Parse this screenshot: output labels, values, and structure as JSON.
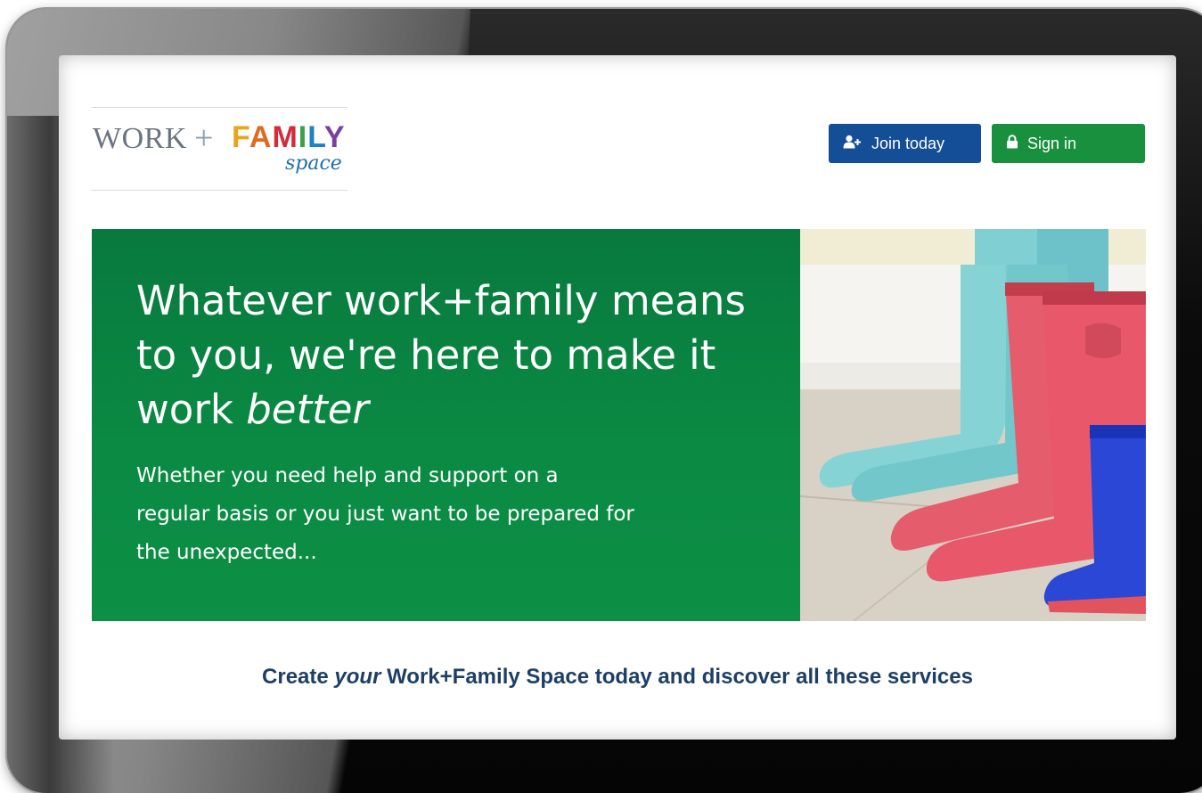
{
  "logo": {
    "work": "WORK",
    "plus": "+",
    "family_letters": [
      "F",
      "A",
      "M",
      "I",
      "L",
      "Y"
    ],
    "space": "space"
  },
  "header": {
    "join_label": "Join today",
    "join_icon": "add-user-icon",
    "sign_in_label": "Sign in",
    "sign_in_icon": "lock-icon"
  },
  "hero": {
    "title_part1": "Whatever work+family means to you, we're here to make it work ",
    "title_emphasis": "better",
    "subtitle": "Whether you need help and support on a regular basis or you just want to be prepared for the unexpected..."
  },
  "caption": {
    "before": "Create ",
    "emphasis": "your",
    "after": " Work+Family Space today and discover all these services"
  },
  "colors": {
    "join_button": "#144e97",
    "sign_in_button": "#19903d",
    "hero_green": "#0a8a43",
    "caption_text": "#1d3f66"
  }
}
